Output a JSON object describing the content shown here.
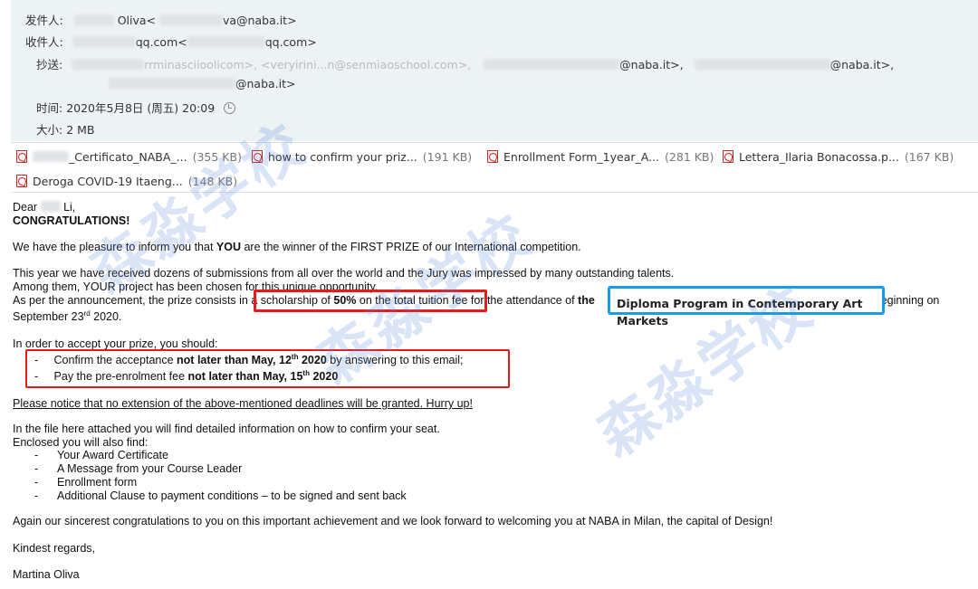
{
  "header": {
    "from_label": "发件人:",
    "from_name": "Oliva",
    "from_email_suffix": "va@naba.it>",
    "to_label": "收件人:",
    "to_value_1": "qq.com<",
    "to_value_2": "qq.com>",
    "cc_label": "抄送:",
    "cc_value_1": "rrminasciioolicom>, <veryirini...n@senmiaoschool.com>,",
    "cc_value_2": "@naba.it>,",
    "cc_value_3": "@naba.it>,",
    "cc_value_4": "@naba.it>",
    "time_label": "时间:",
    "time_value": "2020年5月8日 (周五) 20:09",
    "size_label": "大小:",
    "size_value": "2 MB"
  },
  "attachments": [
    {
      "name": "_Certificato_NABA_...",
      "size": "(355 KB)"
    },
    {
      "name": "how to confirm your priz...",
      "size": "(191 KB)"
    },
    {
      "name": "Enrollment Form_1year_A...",
      "size": "(281 KB)"
    },
    {
      "name": "Lettera_Ilaria Bonacossa.p...",
      "size": "(167 KB)"
    },
    {
      "name": "Deroga COVID-19 Itaeng...",
      "size": "(148 KB)"
    }
  ],
  "body": {
    "greeting": "Dear",
    "greeting_name": "Li,",
    "congrats": "CONGRATULATIONS!",
    "p1_a": "We have the pleasure to inform you that ",
    "p1_you": "YOU",
    "p1_b": " are the winner of the FIRST PRIZE of our International competition.",
    "p2_l1": "This year we have received dozens of submissions from all over the world and the Jury was impressed by many outstanding talents.",
    "p2_l2": "Among them, YOUR project has been chosen for this unique opportunity.",
    "p2_l3_a": "As per the announcement, the prize consists in ",
    "p2_l3_b": "a scholarship of ",
    "p2_l3_pct": "50%",
    "p2_l3_c": " on the total tuition fee",
    "p2_l3_d": " for the attendance of ",
    "p2_l3_the": "the",
    "p2_l3_program": "Diploma Program in Contemporary Art Markets",
    "p2_l3_e": " beginning on",
    "p2_l4_a": "September 23",
    "p2_l4_sup": "rd",
    "p2_l4_b": " 2020.",
    "p3": "In order to accept your prize, you should:",
    "b1_a": "Confirm the acceptance ",
    "b1_bold": "not later than May, 12",
    "b1_sup": "th",
    "b1_year": " 2020",
    "b1_b": " by answering to this email;",
    "b2_a": "Pay the pre-enrolment fee ",
    "b2_bold": "not later than May, 15",
    "b2_sup": "th",
    "b2_year": " 2020",
    "notice": "Please notice that no extension of the above-mentioned deadlines will be granted. Hurry up!",
    "p4_l1": "In the file here attached you will find detailed information on how to confirm your seat.",
    "p4_l2": "Enclosed you will also find:",
    "list": [
      "Your Award Certificate",
      "A Message from your Course Leader",
      "Enrollment form",
      "Additional Clause to payment conditions – to be signed and sent back"
    ],
    "closing": "Again our sincerest congratulations to you on this important achievement and we look forward to welcoming you at NABA in Milan, the capital of Design!",
    "regards": "Kindest regards,",
    "signature": "Martina Oliva"
  },
  "watermark": "森淼学校",
  "colors": {
    "header_bg": "#edf2f4",
    "highlight_red": "#e41c1c",
    "highlight_blue": "#1a9bea",
    "watermark": "#5082dc"
  }
}
